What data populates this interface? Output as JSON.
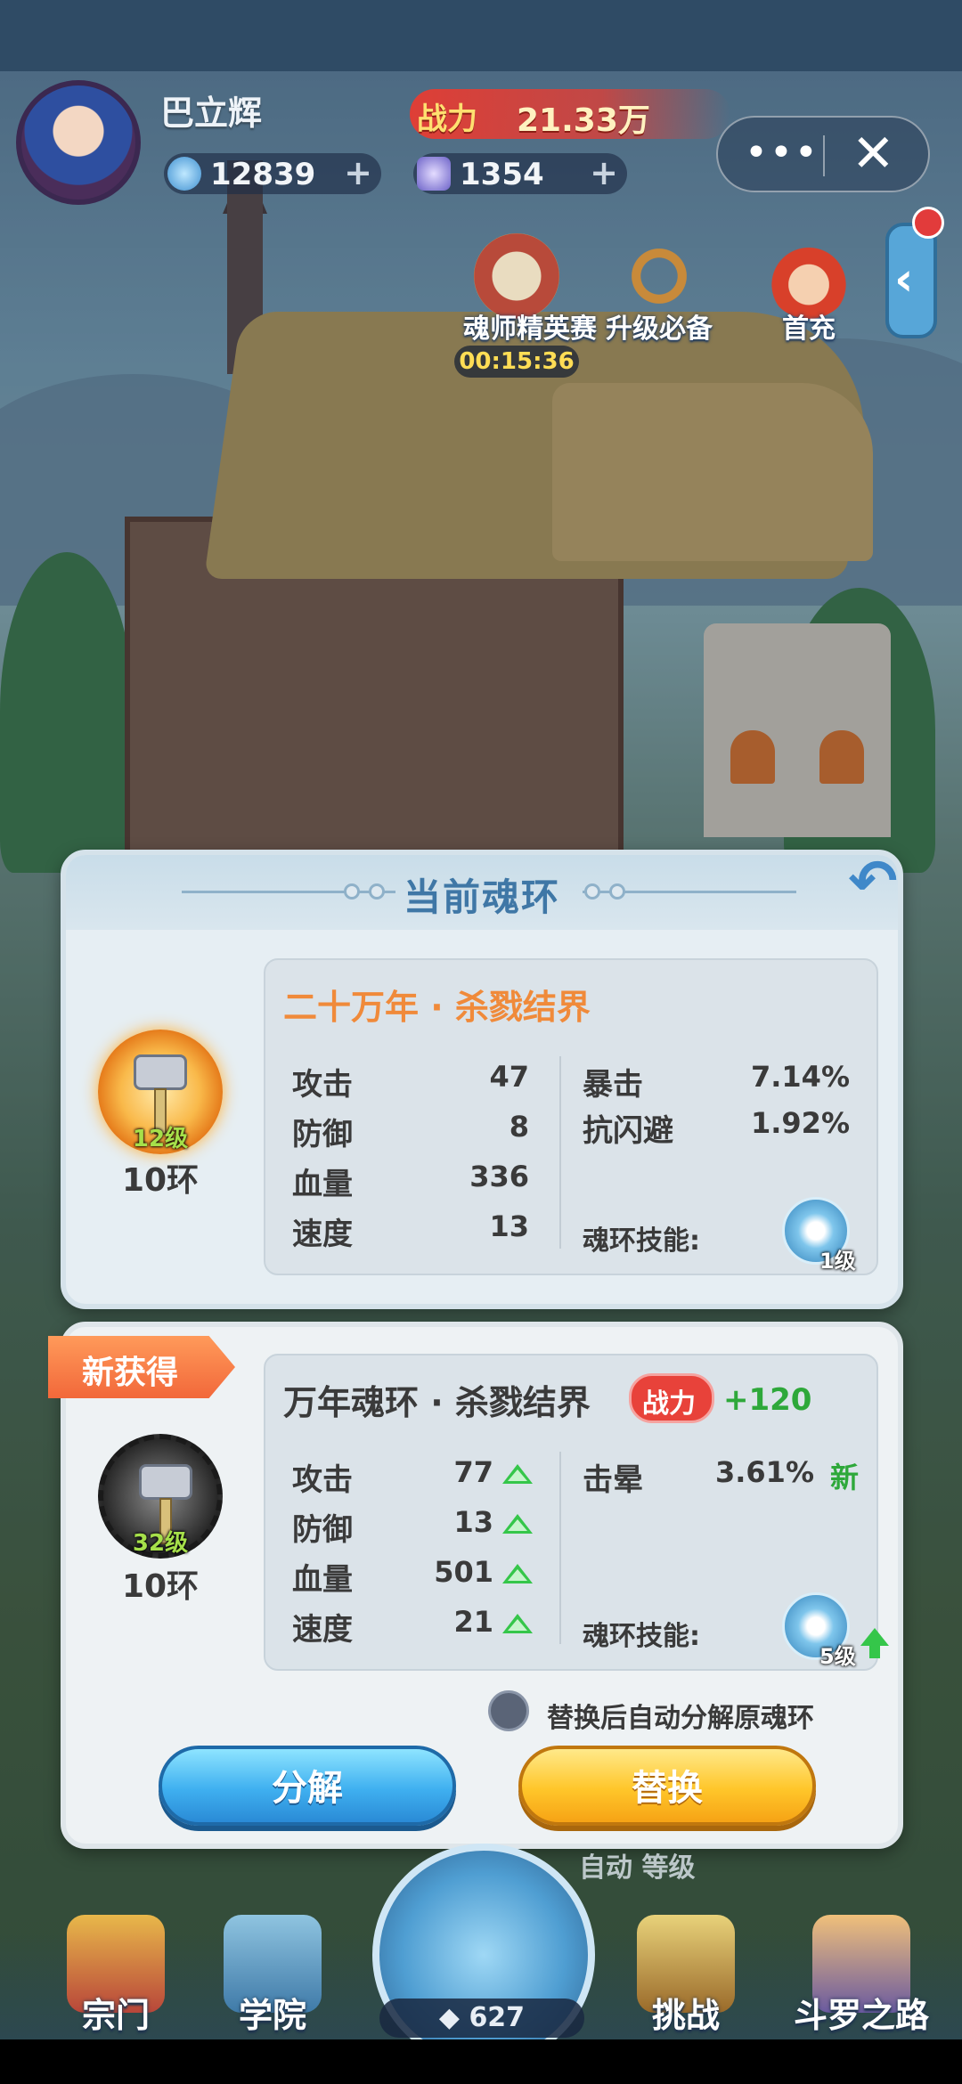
{
  "header": {
    "player_name": "巴立辉",
    "power_label": "战力",
    "power_value": "21.33万",
    "currency_gems": "12839",
    "currency_crystals": "1354",
    "plus": "+",
    "menu_dots": "•••",
    "close": "✕"
  },
  "events": [
    {
      "label": "魂师精英赛",
      "icon": "swords-badge-icon"
    },
    {
      "label": "升级必备",
      "icon": "bracelet-icon"
    },
    {
      "label": "首充",
      "icon": "hero-portrait-icon"
    }
  ],
  "timer": "00:15:36",
  "side_tab": "‹",
  "current_ring": {
    "panel_title": "当前魂环",
    "name": "二十万年 · 杀戮结界",
    "level": "12级",
    "rings": "10环",
    "stats": [
      {
        "label": "攻击",
        "value": "47"
      },
      {
        "label": "防御",
        "value": "8"
      },
      {
        "label": "血量",
        "value": "336"
      },
      {
        "label": "速度",
        "value": "13"
      }
    ],
    "extras": [
      {
        "label": "暴击",
        "value": "7.14%"
      },
      {
        "label": "抗闪避",
        "value": "1.92%"
      }
    ],
    "skill_label": "魂环技能:",
    "skill_level": "1级"
  },
  "new_ring": {
    "ribbon": "新获得",
    "name": "万年魂环 · 杀戮结界",
    "cp_label": "战力",
    "cp_delta": "+120",
    "level": "32级",
    "rings": "10环",
    "stats": [
      {
        "label": "攻击",
        "value": "77"
      },
      {
        "label": "防御",
        "value": "13"
      },
      {
        "label": "血量",
        "value": "501"
      },
      {
        "label": "速度",
        "value": "21"
      }
    ],
    "extras": [
      {
        "label": "击晕",
        "value": "3.61%",
        "tag": "新"
      }
    ],
    "skill_label": "魂环技能:",
    "skill_level": "5级",
    "auto_decompose_label": "替换后自动分解原魂环",
    "decompose_button": "分解",
    "replace_button": "替换"
  },
  "behind_text": "自动   等级",
  "nav": [
    {
      "label": "宗门"
    },
    {
      "label": "学院"
    },
    {
      "label": "挑战"
    },
    {
      "label": "斗罗之路"
    }
  ],
  "orb_count": "627",
  "colors": {
    "ring_title_orange": "#f08a3a",
    "stat_up_green": "#35c64a",
    "power_red": "#e8423a",
    "decompose_blue": "#3fb0f0",
    "replace_yellow": "#ffc62a"
  }
}
